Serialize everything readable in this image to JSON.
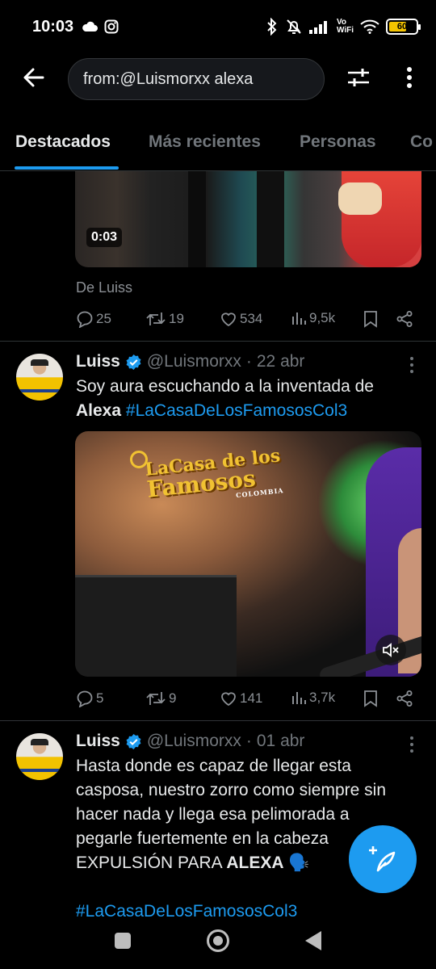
{
  "status_bar": {
    "time": "10:03",
    "vowifi_top": "Vo",
    "vowifi_bottom": "WiFi",
    "battery_level": "60"
  },
  "search": {
    "query": "from:@Luismorxx alexa"
  },
  "tabs": [
    {
      "label": "Destacados",
      "active": true
    },
    {
      "label": "Más recientes",
      "active": false
    },
    {
      "label": "Personas",
      "active": false
    },
    {
      "label": "Co",
      "active": false
    }
  ],
  "tweet0": {
    "video_duration": "0:03",
    "source_label": "De Luiss",
    "replies": "25",
    "retweets": "19",
    "likes": "534",
    "views": "9,5k"
  },
  "tweet1": {
    "name": "Luiss",
    "handle": "@Luismorxx",
    "sep": "·",
    "date": "22 abr",
    "text_line1": "Soy aura escuchando a la inventada de",
    "text_bold": "Alexa",
    "hashtag": "#LaCasaDeLosFamososCol3",
    "media_logo_line1": "LaCasa de los",
    "media_logo_line2": "Famosos",
    "media_logo_line3": "COLOMBIA",
    "replies": "5",
    "retweets": "9",
    "likes": "141",
    "views": "3,7k"
  },
  "tweet2": {
    "name": "Luiss",
    "handle": "@Luismorxx",
    "sep": "·",
    "date": "01 abr",
    "line1": "Hasta donde es capaz de llegar esta",
    "line2": "casposa, nuestro zorro como siempre sin",
    "line3": "hacer nada y llega esa pelimorada a",
    "line4": "pegarle fuertemente en la cabeza",
    "line5_prefix": "EXPULSIÓN PARA ",
    "line5_bold": "ALEXA",
    "line5_emoji": "🗣️",
    "hashtag": "#LaCasaDeLosFamososCol3"
  },
  "colors": {
    "accent": "#1d9bf0",
    "background": "#000000",
    "secondary_text": "#71767b"
  }
}
